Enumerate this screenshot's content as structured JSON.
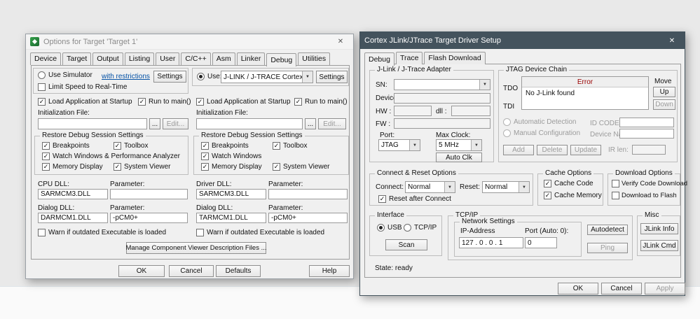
{
  "icons": {
    "close": "✕",
    "dropdown": "▼",
    "check": "✓"
  },
  "colors": {
    "active_titlebar": "#44535d",
    "error_header": "#990000",
    "link": "#0451a5"
  },
  "opt": {
    "title": "Options for Target 'Target 1'",
    "tabs": [
      "Device",
      "Target",
      "Output",
      "Listing",
      "User",
      "C/C++",
      "Asm",
      "Linker",
      "Debug",
      "Utilities"
    ],
    "sim": {
      "use_simulator": "Use Simulator",
      "restrictions": "with restrictions",
      "settings": "Settings",
      "limit_speed": "Limit Speed to Real-Time",
      "load_app": "Load Application at Startup",
      "run_main": "Run to main()",
      "init_file": "Initialization File:",
      "browse": "...",
      "edit": "Edit...",
      "restore": "Restore Debug Session Settings",
      "breakpoints": "Breakpoints",
      "toolbox": "Toolbox",
      "watch": "Watch Windows & Performance Analyzer",
      "memory": "Memory Display",
      "sysviewer": "System Viewer",
      "cpu_dll": "CPU DLL:",
      "param": "Parameter:",
      "cpu_dll_value": "SARMCM3.DLL",
      "cpu_param_value": "",
      "dlg_dll": "Dialog DLL:",
      "dlg_dll_value": "DARMCM1.DLL",
      "dlg_param_value": "-pCM0+",
      "warn": "Warn if outdated Executable is loaded"
    },
    "drv": {
      "use": "Use:",
      "driver": "J-LINK / J-TRACE Cortex",
      "settings": "Settings",
      "load_app": "Load Application at Startup",
      "run_main": "Run to main()",
      "init_file": "Initialization File:",
      "browse": "...",
      "edit": "Edit...",
      "restore": "Restore Debug Session Settings",
      "breakpoints": "Breakpoints",
      "toolbox": "Toolbox",
      "watch": "Watch Windows",
      "memory": "Memory Display",
      "sysviewer": "System Viewer",
      "drv_dll": "Driver DLL:",
      "param": "Parameter:",
      "drv_dll_value": "SARMCM3.DLL",
      "drv_param_value": "",
      "dlg_dll": "Dialog DLL:",
      "dlg_dll_value": "TARMCM1.DLL",
      "dlg_param_value": "-pCM0+",
      "warn": "Warn if outdated Executable is loaded",
      "manage": "Manage Component Viewer Description Files ..."
    },
    "footer": {
      "ok": "OK",
      "cancel": "Cancel",
      "defaults": "Defaults",
      "help": "Help"
    }
  },
  "jl": {
    "title": "Cortex JLink/JTrace Target Driver Setup",
    "tabs": [
      "Debug",
      "Trace",
      "Flash Download"
    ],
    "adapter": {
      "title": "J-Link / J-Trace Adapter",
      "sn": "SN:",
      "device": "Device:",
      "hw": "HW :",
      "dll": "dll :",
      "fw": "FW :",
      "port": "Port:",
      "max_clock": "Max Clock:",
      "port_value": "JTAG",
      "clock_value": "5 MHz",
      "auto_clk": "Auto Clk"
    },
    "chain": {
      "title": "JTAG Device Chain",
      "move": "Move",
      "tdo": "TDO",
      "tdi": "TDI",
      "error_header": "Error",
      "error_row": "No J-Link found",
      "up": "Up",
      "down": "Down",
      "auto_detect": "Automatic Detection",
      "id_code": "ID CODE:",
      "manual_config": "Manual Configuration",
      "device_name": "Device Name:",
      "add": "Add",
      "delete": "Delete",
      "update": "Update",
      "ir_len": "IR len:"
    },
    "connect": {
      "title": "Connect & Reset Options",
      "connect": "Connect:",
      "connect_value": "Normal",
      "reset": "Reset:",
      "reset_value": "Normal",
      "reset_after": "Reset after Connect"
    },
    "cache": {
      "title": "Cache Options",
      "code": "Cache Code",
      "memory": "Cache Memory"
    },
    "download": {
      "title": "Download Options",
      "verify": "Verify Code Download",
      "flash": "Download to Flash"
    },
    "iface": {
      "title": "Interface",
      "usb": "USB",
      "tcpip": "TCP/IP",
      "scan": "Scan"
    },
    "tcpip": {
      "title": "TCP/IP",
      "network": "Network Settings",
      "ip_label": "IP-Address",
      "ip_value": "127  .  0  .  0  .  1",
      "port_label": "Port (Auto: 0):",
      "port_value": "0",
      "autodetect": "Autodetect",
      "ping": "Ping"
    },
    "misc": {
      "title": "Misc",
      "info": "JLink Info",
      "cmd": "JLink Cmd"
    },
    "state": "State: ready",
    "footer": {
      "ok": "OK",
      "cancel": "Cancel",
      "apply": "Apply"
    }
  }
}
